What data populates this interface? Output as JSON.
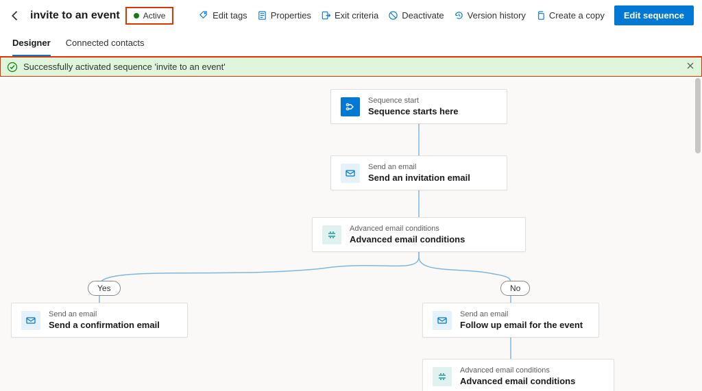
{
  "header": {
    "title": "invite to an event",
    "status": "Active"
  },
  "actions": {
    "edit_tags": "Edit tags",
    "properties": "Properties",
    "exit_criteria": "Exit criteria",
    "deactivate": "Deactivate",
    "version_history": "Version history",
    "create_copy": "Create a copy",
    "edit_sequence": "Edit sequence"
  },
  "tabs": {
    "designer": "Designer",
    "connected": "Connected contacts"
  },
  "notice": "Successfully activated sequence 'invite to an event'",
  "branch": {
    "yes": "Yes",
    "no": "No"
  },
  "nodes": {
    "start": {
      "label": "Sequence start",
      "title": "Sequence starts here"
    },
    "email1": {
      "label": "Send an email",
      "title": "Send an invitation email"
    },
    "cond1": {
      "label": "Advanced email conditions",
      "title": "Advanced email conditions"
    },
    "yesMail": {
      "label": "Send an email",
      "title": "Send a confirmation email"
    },
    "noMail": {
      "label": "Send an email",
      "title": "Follow up email for the event"
    },
    "cond2": {
      "label": "Advanced email conditions",
      "title": "Advanced email conditions"
    }
  }
}
